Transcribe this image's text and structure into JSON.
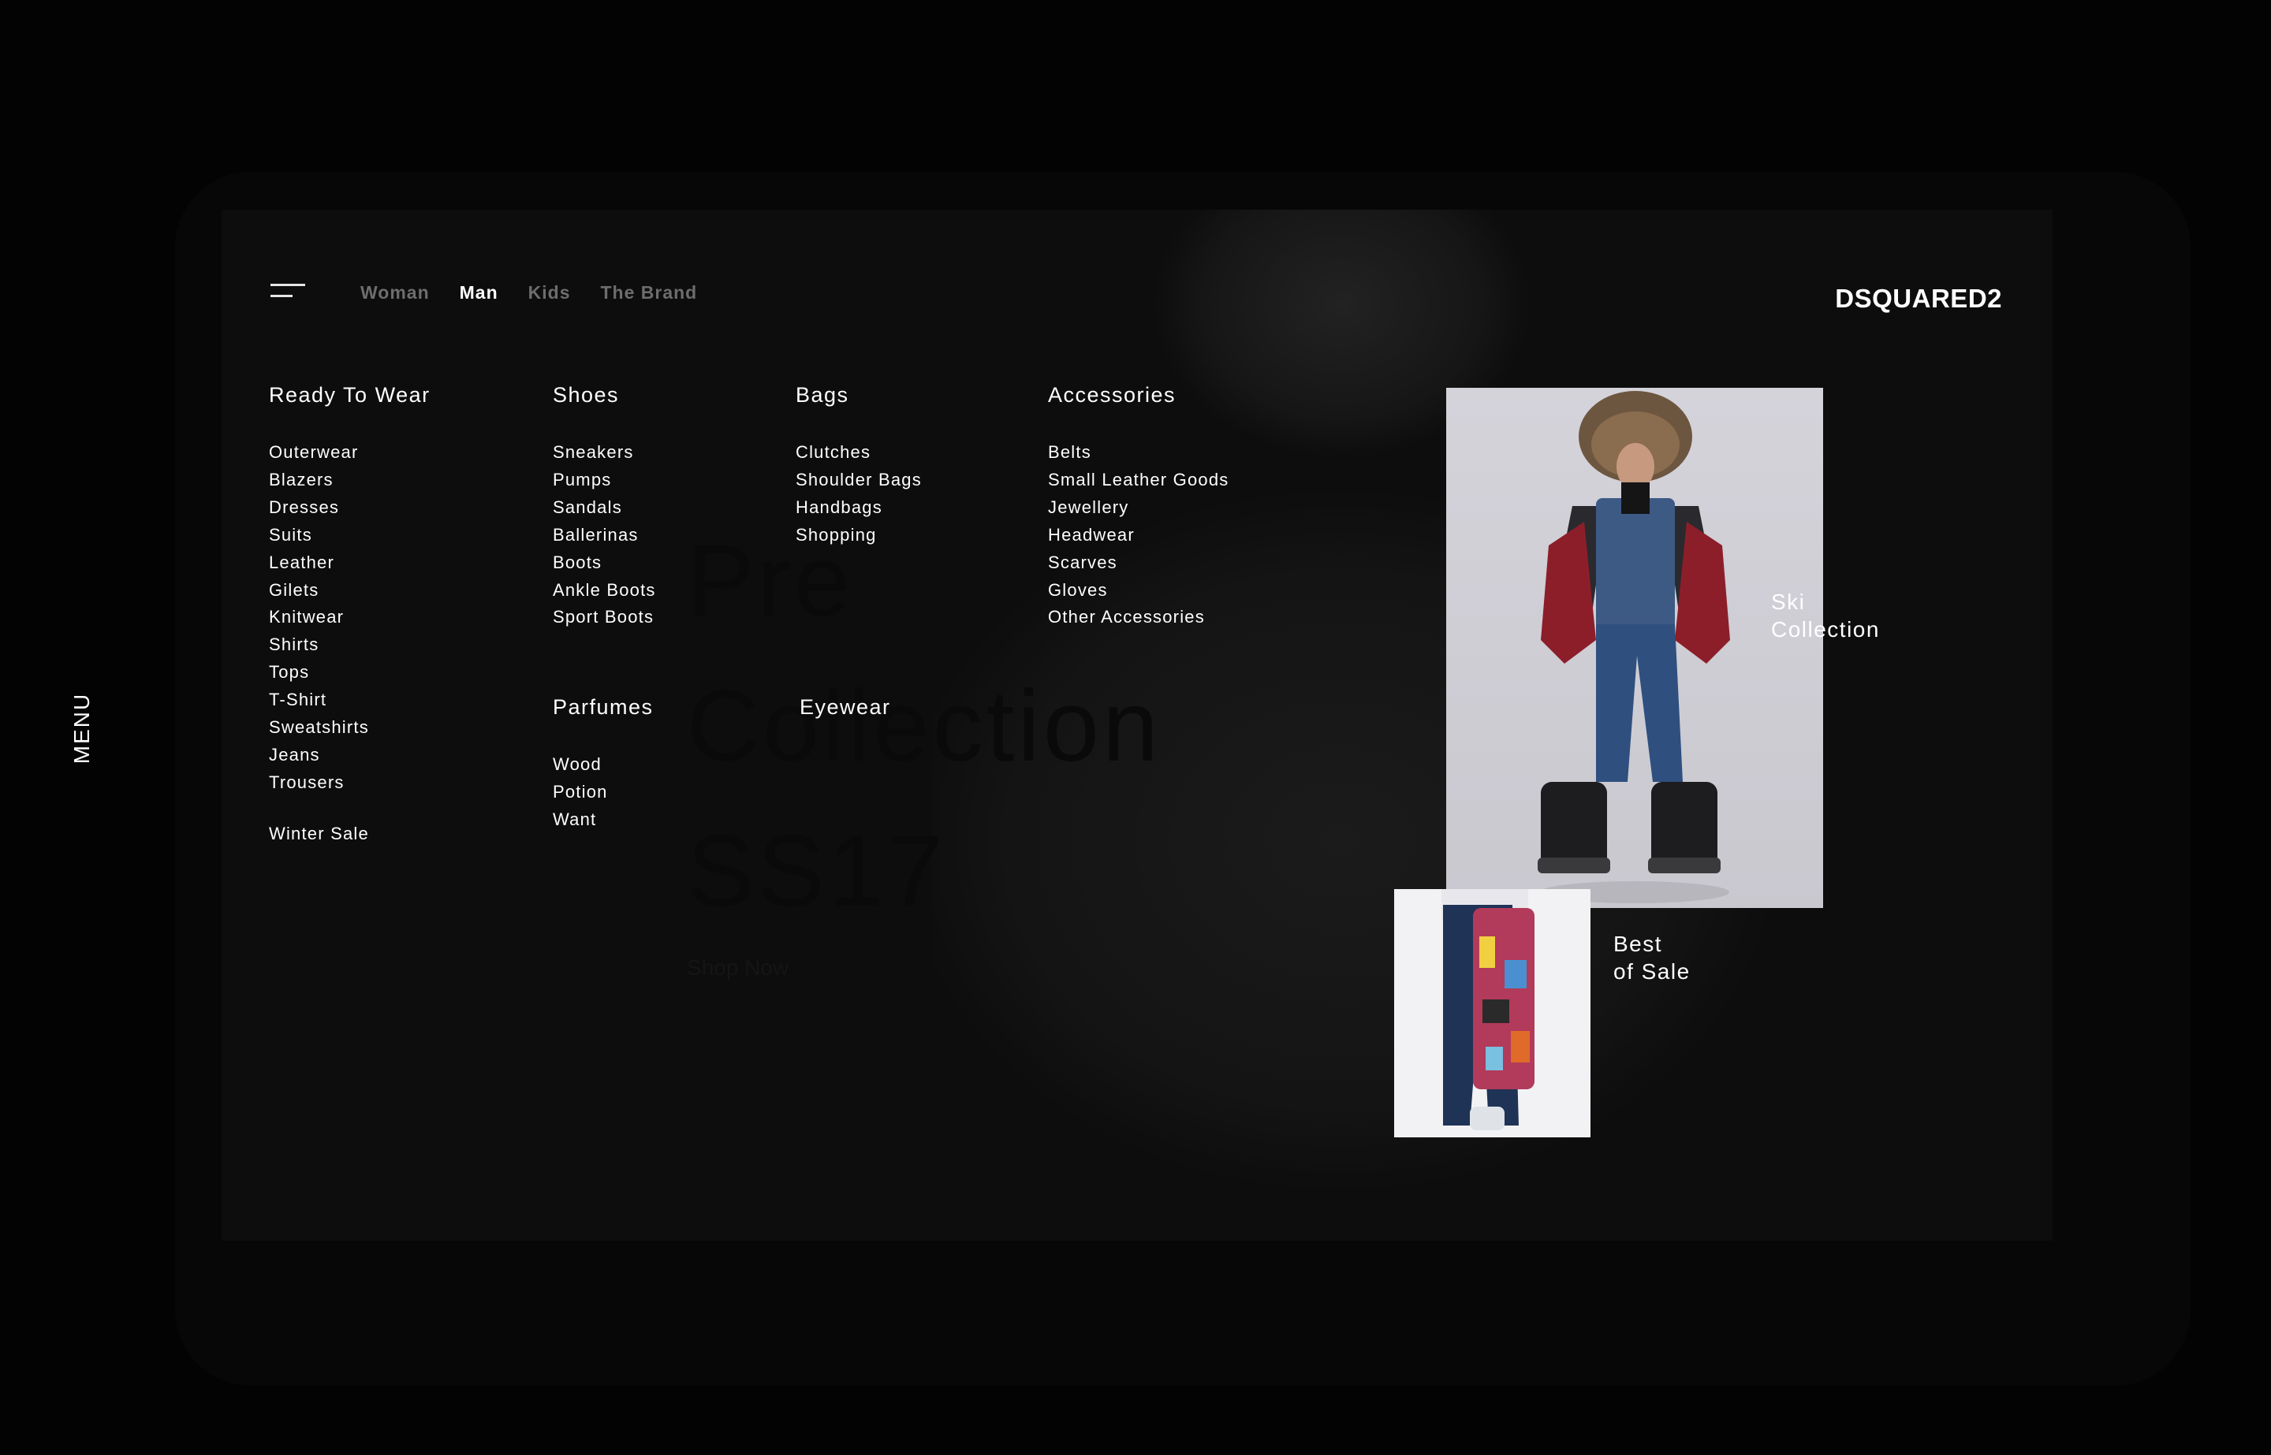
{
  "side_menu": {
    "label": "MENU"
  },
  "hero": {
    "headline_lines": [
      "Pre",
      "Collection",
      "SS17"
    ],
    "cta": "Shop Now"
  },
  "nav": {
    "items": [
      {
        "label": "Woman",
        "active": false
      },
      {
        "label": "Man",
        "active": true
      },
      {
        "label": "Kids",
        "active": false
      },
      {
        "label": "The Brand",
        "active": false
      }
    ]
  },
  "brand": {
    "logo": "DSQUARED2"
  },
  "menu": {
    "ready_to_wear": {
      "title": "Ready To Wear",
      "items": [
        "Outerwear",
        "Blazers",
        "Dresses",
        "Suits",
        "Leather",
        "Gilets",
        "Knitwear",
        "Shirts",
        "Tops",
        "T-Shirt",
        "Sweatshirts",
        "Jeans",
        "Trousers"
      ],
      "extra": "Winter Sale"
    },
    "shoes": {
      "title": "Shoes",
      "items": [
        "Sneakers",
        "Pumps",
        "Sandals",
        "Ballerinas",
        "Boots",
        "Ankle Boots",
        "Sport Boots"
      ]
    },
    "bags": {
      "title": "Bags",
      "items": [
        "Clutches",
        "Shoulder Bags",
        "Handbags",
        "Shopping"
      ]
    },
    "accessories": {
      "title": "Accessories",
      "items": [
        "Belts",
        "Small Leather Goods",
        "Jewellery",
        "Headwear",
        "Scarves",
        "Gloves",
        "Other Accessories"
      ]
    },
    "parfumes": {
      "title": "Parfumes",
      "items": [
        "Wood",
        "Potion",
        "Want"
      ]
    },
    "eyewear": {
      "title": "Eyewear"
    }
  },
  "promos": {
    "ski": {
      "line1": "Ski",
      "line2": "Collection"
    },
    "sale": {
      "line1": "Best",
      "line2": "of Sale"
    }
  },
  "colors": {
    "background": "#030304",
    "screen": "#0d0d0e",
    "text": "#ffffff",
    "nav_inactive": "#6d6d6d"
  }
}
